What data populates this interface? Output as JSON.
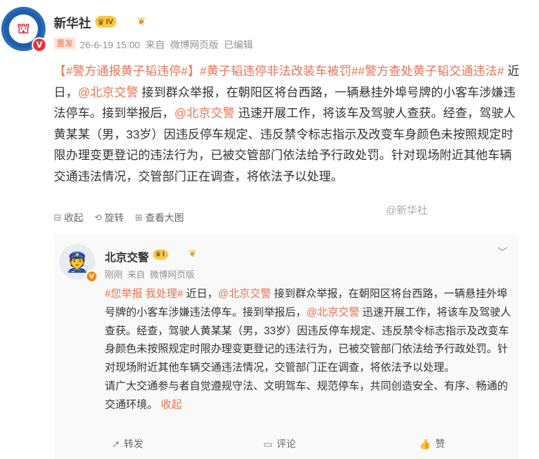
{
  "post": {
    "author": "新华社",
    "level_badge": "IV",
    "avatar_badge": "V",
    "tag": "置发",
    "meta": [
      "26-6-19 15:00",
      "来自",
      "微博网页版",
      "已编辑"
    ],
    "text_segments": [
      {
        "text": "【#警方通报黄子韬违停#】#黄子韬违停非法改装车被罚##警方查处黄子韬交通违法#",
        "hl": true
      },
      {
        "text": " 近日，",
        "hl": false
      },
      {
        "text": "@北京交警",
        "hl": true
      },
      {
        "text": " 接到群众举报，在朝阳区将台西路，一辆悬挂外埠号牌的小客车涉嫌违法停车。接到举报后，",
        "hl": false
      },
      {
        "text": "@北京交警",
        "hl": true
      },
      {
        "text": " 迅速开展工作，将该车及驾驶人查获。经查，驾驶人黄某某（男，33岁）因违反停车规定、违反禁令标志指示及改变车身颜色未按照规定时限办理变更登记的违法行为，已被交管部门依法给予行政处罚。针对现场附近其他车辆交通违法情况，交管部门正在调查，将依法予以处理。",
        "hl": false
      }
    ],
    "actions": [
      {
        "icon": "collapse-icon",
        "label": "收起"
      },
      {
        "icon": "rotate-icon",
        "label": "旋转"
      },
      {
        "icon": "view-large-icon",
        "label": "查看大图"
      }
    ]
  },
  "quote": {
    "author": "北京交警",
    "level_badge": "I",
    "avatar_badge": "V",
    "meta": [
      "刚刚",
      "来自",
      "微博网页版"
    ],
    "text_segments": [
      {
        "text": "#您举报 我处理#",
        "hl": true
      },
      {
        "text": " 近日，",
        "hl": false
      },
      {
        "text": "@北京交警",
        "hl": true
      },
      {
        "text": " 接到群众举报，在朝阳区将台西路，一辆悬挂外埠号牌的小客车涉嫌违法停车。接到举报后，",
        "hl": false
      },
      {
        "text": "@北京交警",
        "hl": true
      },
      {
        "text": " 迅速开展工作，将该车及驾驶人查获。经查，驾驶人黄某某（男，33岁）因违反停车规定、违反禁令标志指示及改变车身颜色未按照规定时限办理变更登记的违法行为，已被交管部门依法给予行政处罚。针对现场附近其他车辆交通违法情况，交管部门正在调查，将依法予以处理。",
        "hl": false
      },
      {
        "text": "\n请广大交通参与者自觉遵规守法、文明驾车、规范停车，共同创造安全、有序、畅通的交通环境。",
        "hl": false
      },
      {
        "text": " 收起",
        "hl": true
      }
    ],
    "actions": [
      {
        "icon": "repost-icon",
        "label": "转发"
      },
      {
        "icon": "comment-icon",
        "label": "评论"
      },
      {
        "icon": "like-icon",
        "label": "赞"
      }
    ]
  },
  "watermark": "@新华社",
  "colors": {
    "accent": "#eb7350",
    "badge_red": "#e8333d",
    "gold": "#f6c94a"
  }
}
